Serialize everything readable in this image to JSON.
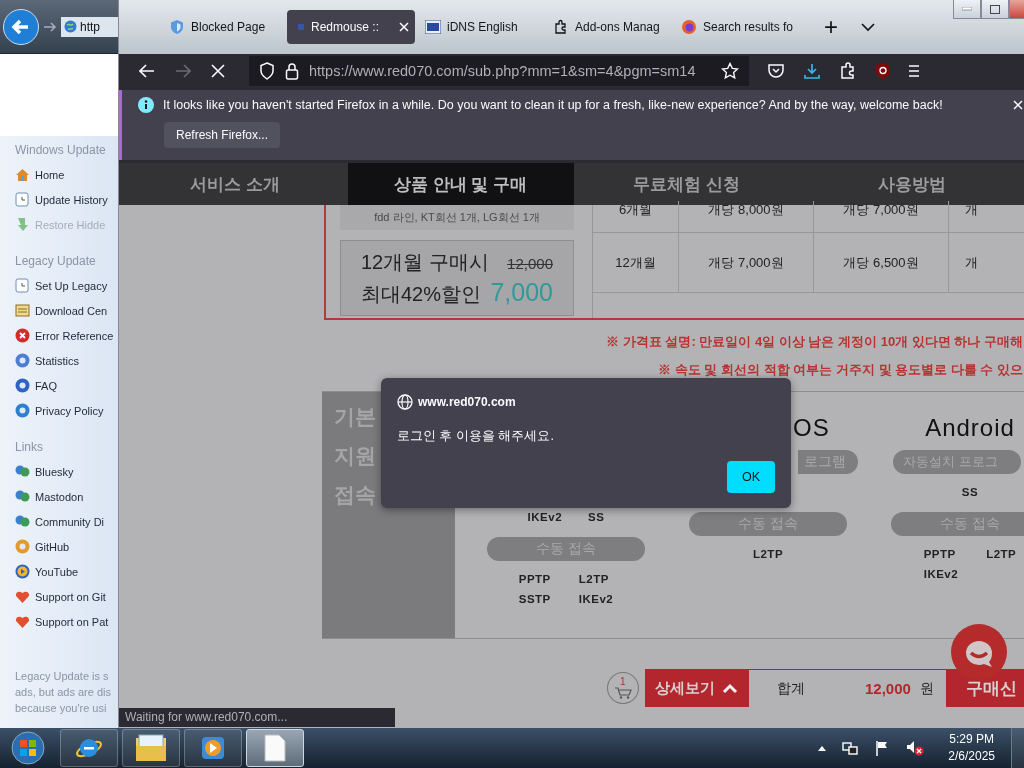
{
  "background_window": {
    "address": "http",
    "sidebar": [
      {
        "heading": "Windows Update",
        "items": [
          {
            "label": "Home",
            "disabled": false
          },
          {
            "label": "Update History",
            "disabled": false
          },
          {
            "label": "Restore Hidde",
            "disabled": true
          }
        ]
      },
      {
        "heading": "Legacy Update",
        "items": [
          {
            "label": "Set Up Legacy",
            "disabled": false
          },
          {
            "label": "Download Cen",
            "disabled": false
          },
          {
            "label": "Error Reference",
            "disabled": false
          },
          {
            "label": "Statistics",
            "disabled": false
          },
          {
            "label": "FAQ",
            "disabled": false
          },
          {
            "label": "Privacy Policy",
            "disabled": false
          }
        ]
      },
      {
        "heading": "Links",
        "items": [
          {
            "label": "Bluesky",
            "disabled": false
          },
          {
            "label": "Mastodon",
            "disabled": false
          },
          {
            "label": "Community Di",
            "disabled": false
          },
          {
            "label": "GitHub",
            "disabled": false
          },
          {
            "label": "YouTube",
            "disabled": false
          },
          {
            "label": "Support on Git",
            "disabled": false
          },
          {
            "label": "Support on Pat",
            "disabled": false
          }
        ]
      }
    ],
    "footer": [
      "Legacy Update is s",
      "ads, but ads are dis",
      "because you're usi"
    ]
  },
  "browser": {
    "tabs": [
      {
        "label": "Blocked Page",
        "selected": false
      },
      {
        "label": "Redmouse ::",
        "selected": true
      },
      {
        "label": "iDNS English",
        "selected": false
      },
      {
        "label": "Add-ons Manag",
        "selected": false
      },
      {
        "label": "Search results fo",
        "selected": false
      }
    ],
    "new_tab": "+",
    "toolbar": {
      "forward_disabled": true,
      "url": "https://www.red070.com/sub.php?mm=1&sm=4&pgm=sm14"
    },
    "notification": {
      "message": "It looks like you haven't started Firefox in a while. Do you want to clean it up for a fresh, like-new experience? And by the way, welcome back!",
      "button": "Refresh Firefox..."
    },
    "page": {
      "nav": [
        {
          "label": "서비스 소개",
          "selected": false
        },
        {
          "label": "상품 안내 및 구매",
          "selected": true
        },
        {
          "label": "무료체험 신청",
          "selected": false
        },
        {
          "label": "사용방법",
          "selected": false
        }
      ],
      "card_text": "fdd 라인, KT회선 1개, LG회선 1개",
      "offer": {
        "title": "12개월 구매시",
        "original_price": "12,000",
        "subtitle": "최대42%할인",
        "price": "7,000"
      },
      "price_rows": [
        [
          "6개월",
          "개당 8,000원",
          "개당 7,000원",
          "개"
        ],
        [
          "12개월",
          "개당 7,000원",
          "개당 6,500원",
          "개"
        ]
      ],
      "notes": [
        "※ 가격표 설명: 만료일이 4일 이상 남은 계정이 10개 있다면 하나 구매해",
        "※ 속도 및 회선의 적합 여부는 거주지 및 용도별로 다를 수 있으"
      ],
      "connect_labels": [
        "기본",
        "지원",
        "접속"
      ],
      "columns": [
        {
          "auto_protocols": [
            "IKEv2",
            "SS"
          ],
          "manual_label": "수동 접속",
          "manual_protocols": [
            "PPTP",
            "L2TP",
            "SSTP",
            "IKEv2"
          ]
        },
        {
          "heading": "OS",
          "auto_label": "로그램",
          "manual_label": "수동 접속",
          "manual_protocols": [
            "L2TP"
          ]
        },
        {
          "heading": "Android",
          "auto_label": "자동설치 프로그",
          "auto_protocols": [
            "SS"
          ],
          "manual_label": "수동 접속",
          "manual_protocols": [
            "PPTP",
            "L2TP",
            "IKEv2"
          ]
        }
      ],
      "bottom_bar": {
        "cart_count": "1",
        "details_button": "상세보기",
        "total_label": "합계",
        "total": "12,000",
        "currency": "원",
        "buy_button": "구매신"
      }
    },
    "dialog": {
      "origin": "www.red070.com",
      "message": "로그인 후 이용을 해주세요.",
      "button": "OK"
    },
    "status": "Waiting for www.red070.com..."
  },
  "taskbar": {
    "apps": [
      {
        "selected": false
      },
      {
        "selected": false
      },
      {
        "selected": false
      },
      {
        "selected": true
      }
    ],
    "time": "5:29 PM",
    "date": "2/6/2025"
  }
}
